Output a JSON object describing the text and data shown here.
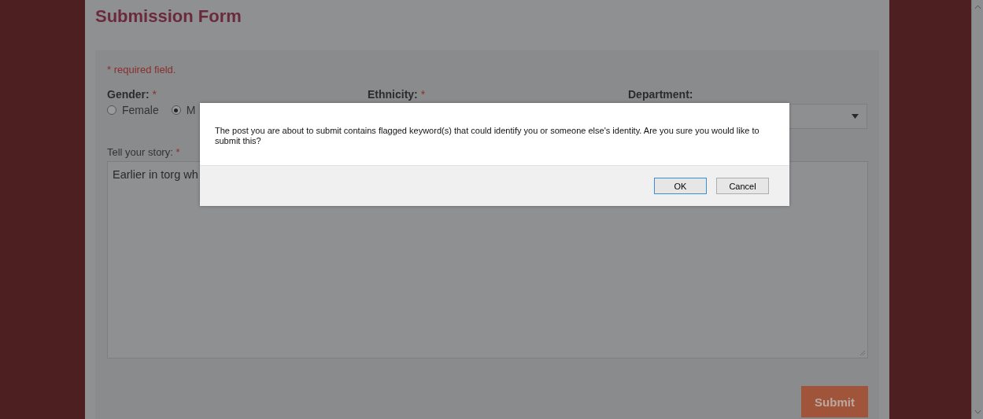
{
  "page": {
    "title": "Submission Form"
  },
  "form": {
    "required_note": "* required field.",
    "gender": {
      "label": "Gender:",
      "required_mark": "*",
      "options": [
        {
          "label": "Female",
          "selected": false
        },
        {
          "label": "M",
          "selected": true
        }
      ]
    },
    "ethnicity": {
      "label": "Ethnicity:",
      "required_mark": "*"
    },
    "department": {
      "label": "Department:"
    },
    "story": {
      "label": "Tell your story:",
      "required_mark": "*",
      "value": "Earlier in torg wh"
    },
    "submit": "Submit"
  },
  "dialog": {
    "message": "The post you are about to submit contains flagged keyword(s) that could identify you or someone else's identity. Are you sure you would like to submit this?",
    "buttons": [
      {
        "label": "OK",
        "focused": true
      },
      {
        "label": "Cancel",
        "focused": false
      }
    ]
  }
}
